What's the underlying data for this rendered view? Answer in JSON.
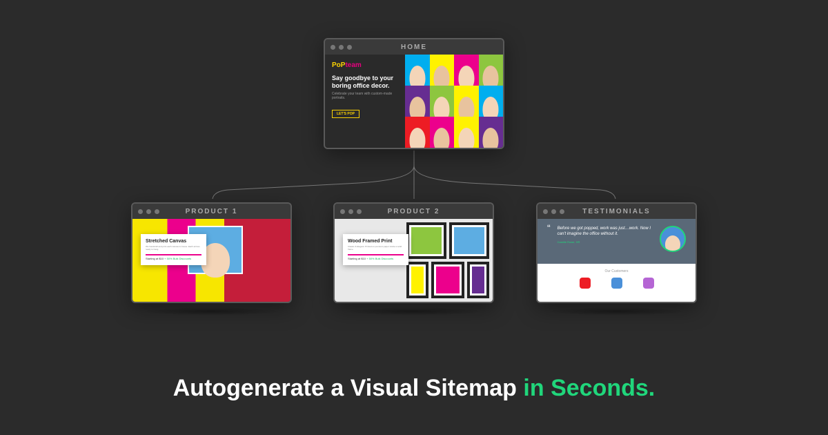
{
  "windows": {
    "home": {
      "title": "HOME"
    },
    "product1": {
      "title": "PRODUCT 1"
    },
    "product2": {
      "title": "PRODUCT 2"
    },
    "testimonials": {
      "title": "TESTIMONIALS"
    }
  },
  "home_content": {
    "logo_part1": "PoP",
    "logo_part2": "team",
    "headline": "Say goodbye to your boring office decor.",
    "subline": "Celebrate your team with custom-made portraits.",
    "cta": "LET'S POP"
  },
  "product1": {
    "card_title": "Stretched Canvas",
    "card_sub": "We handcraft and print each canvas in-house. Each arrives ready to hang.",
    "price_prefix": "Starting at $10",
    "price_discount": "+ 50% Bulk Discounts"
  },
  "product2": {
    "card_title": "Wood Framed Print",
    "card_sub": "Classic & Elegant. Printed on premium paper inside a solid frame.",
    "price_prefix": "Starting at $10",
    "price_discount": "+ 50% Bulk Discounts"
  },
  "testimonials": {
    "quote": "“",
    "text": "Before we got popped, work was just…work. Now I can't imagine the office without it.",
    "author": "Camille Rowe, HR",
    "customers_label": "Our Customers"
  },
  "headline": {
    "main": "Autogenerate a Visual Sitemap ",
    "accent": "in Seconds."
  },
  "colors": {
    "accent": "#20d67b",
    "bg": "#2b2b2b"
  }
}
